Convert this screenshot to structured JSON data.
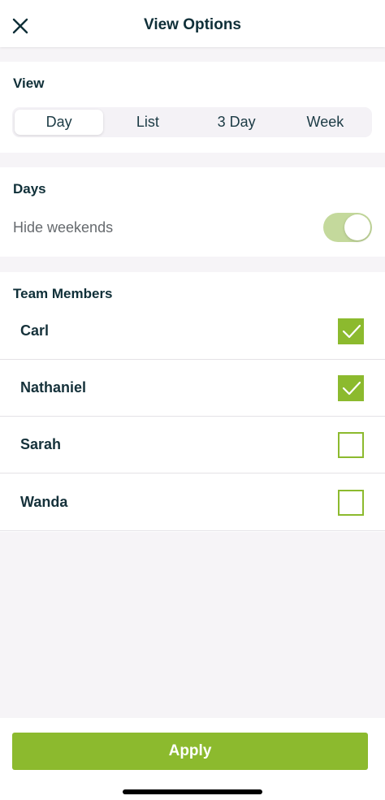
{
  "header": {
    "title": "View Options",
    "close_icon": "close-icon"
  },
  "view": {
    "title": "View",
    "options": [
      "Day",
      "List",
      "3 Day",
      "Week"
    ],
    "selected": "Day"
  },
  "days": {
    "title": "Days",
    "hide_weekends_label": "Hide weekends",
    "hide_weekends_on": true
  },
  "team": {
    "title": "Team Members",
    "members": [
      {
        "name": "Carl",
        "checked": true
      },
      {
        "name": "Nathaniel",
        "checked": true
      },
      {
        "name": "Sarah",
        "checked": false
      },
      {
        "name": "Wanda",
        "checked": false
      }
    ]
  },
  "footer": {
    "apply_label": "Apply"
  },
  "colors": {
    "accent": "#8cba2e",
    "toggle_track": "#c4d99c",
    "text_dark": "#0f2f38",
    "background": "#f6f4f7"
  }
}
